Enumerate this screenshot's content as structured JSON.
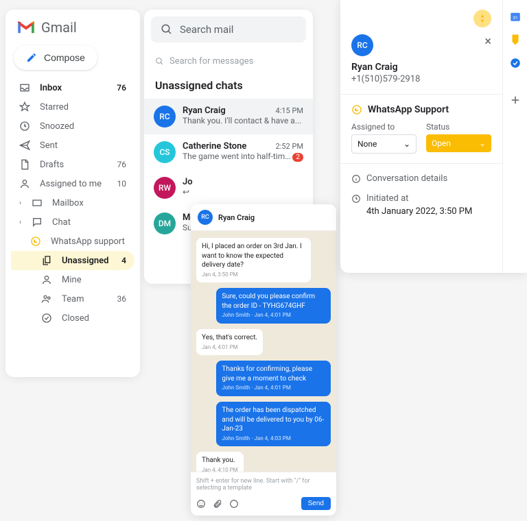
{
  "gmail": {
    "brand": "Gmail",
    "compose": "Compose",
    "nav": [
      {
        "label": "Inbox",
        "count": "76"
      },
      {
        "label": "Starred"
      },
      {
        "label": "Snoozed"
      },
      {
        "label": "Sent"
      },
      {
        "label": "Drafts",
        "count": "76"
      },
      {
        "label": "Assigned to me",
        "count": "10"
      },
      {
        "label": "Mailbox"
      },
      {
        "label": "Chat"
      },
      {
        "label": "WhatsApp support"
      },
      {
        "label": "Unassigned",
        "count": "4"
      },
      {
        "label": "Mine"
      },
      {
        "label": "Team",
        "count": "36"
      },
      {
        "label": "Closed"
      }
    ]
  },
  "chatlist": {
    "search_mail_placeholder": "Search mail",
    "search_messages_placeholder": "Search for messages",
    "section_title": "Unassigned chats",
    "items": [
      {
        "initials": "RC",
        "color": "#1a73e8",
        "name": "Ryan Craig",
        "time": "4:15 PM",
        "preview": "Thank you. I'll contact & have a..."
      },
      {
        "initials": "CS",
        "color": "#26c6da",
        "name": "Catherine Stone",
        "time": "2:52 PM",
        "preview": "The game went into half-time...",
        "badge": "2"
      },
      {
        "initials": "RW",
        "color": "#c2185b",
        "name": "Jo",
        "preview": "↩"
      },
      {
        "initials": "DM",
        "color": "#26a69a",
        "name": "Mo",
        "preview": "Su"
      }
    ]
  },
  "conversation": {
    "header_initials": "RC",
    "header_name": "Ryan Craig",
    "messages": [
      {
        "dir": "in",
        "text": "Hi, I placed an order on 3rd Jan. I want to know the expected delivery date?",
        "meta": "Jan 4, 3:50 PM"
      },
      {
        "dir": "out",
        "text": "Sure, could you please confirm the order ID - TYHG674GHF",
        "meta": "John Smith · Jan 4, 4:01 PM"
      },
      {
        "dir": "in",
        "text": "Yes, that's correct.",
        "meta": "Jan 4, 4:01 PM"
      },
      {
        "dir": "out",
        "text": "Thanks for confirming, please give me a moment to check",
        "meta": "John Smith · Jan 4, 4:01 PM"
      },
      {
        "dir": "out",
        "text": "The order has been dispatched and will be delivered to you by 06-Jan-23",
        "meta": "John Smith · Jan 4, 4:03 PM"
      },
      {
        "dir": "in",
        "text": "Thank you.",
        "meta": "Jan 4, 4:10 PM"
      }
    ],
    "input_placeholder": "Shift + enter for new line. Start with \"/\" for selecting a template",
    "send_label": "Send"
  },
  "details": {
    "contact_initials": "RC",
    "contact_name": "Ryan Craig",
    "contact_phone": "+1(510)579-2918",
    "whatsapp_support_label": "WhatsApp Support",
    "assigned_label": "Assigned to",
    "assigned_value": "None",
    "status_label": "Status",
    "status_value": "Open",
    "conversation_details_label": "Conversation details",
    "initiated_label": "Initiated at",
    "initiated_value": "4th January 2022, 3:50 PM"
  }
}
